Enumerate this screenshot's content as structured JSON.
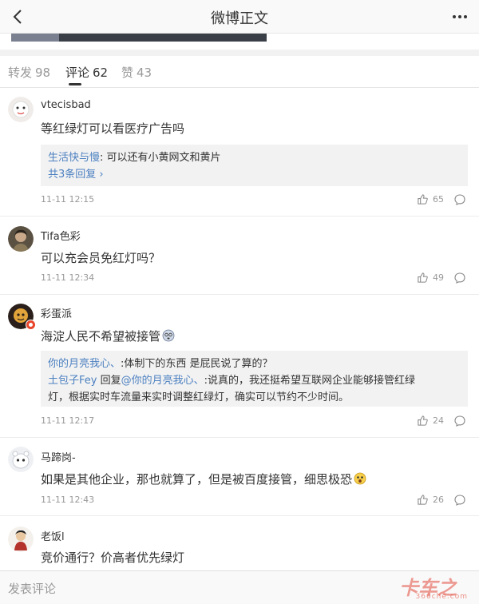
{
  "header": {
    "title": "微博正文",
    "back_icon": "chevron-left-icon",
    "more_icon": "ellipsis-icon"
  },
  "tabs": [
    {
      "label": "转发",
      "count": "98",
      "active": false
    },
    {
      "label": "评论",
      "count": "62",
      "active": true
    },
    {
      "label": "赞",
      "count": "43",
      "active": false
    }
  ],
  "comments": [
    {
      "user": "vtecisbad",
      "text": "等红绿灯可以看医疗广告吗",
      "replies": [
        {
          "name": "生活快与慢",
          "text": ": 可以还有小黄网文和黄片"
        }
      ],
      "more_replies": "共3条回复",
      "time": "11-11 12:15",
      "likes": "65"
    },
    {
      "user": "Tifa色彩",
      "text": "可以充会员免红灯吗？",
      "time": "11-11 12:34",
      "likes": "49"
    },
    {
      "user": "彩蛋派",
      "text": "海淀人民不希望被接管",
      "replies": [
        {
          "name": "你的月亮我心、",
          "text": ":体制下的东西 是屁民说了算的？"
        },
        {
          "name": "土包子Fey",
          "mid": " 回复",
          "mention": "@你的月亮我心、",
          "text": ":说真的，我还挺希望互联网企业能够接管红绿",
          "text2": "灯，根据实时车流量来实时调整红绿灯，确实可以节约不少时间。"
        }
      ],
      "time": "11-11 12:17",
      "likes": "24"
    },
    {
      "user": "马蹄岗-",
      "text": "如果是其他企业，那也就算了，但是被百度接管，细思极恐",
      "time": "11-11 12:43",
      "likes": "26"
    },
    {
      "user": "老饭l",
      "text": "竞价通行？价高者优先绿灯"
    }
  ],
  "bottom": {
    "compose_placeholder": "发表评论"
  },
  "watermark": {
    "brand": "卡车之家",
    "domain": "360che.com"
  },
  "colors": {
    "link": "#4c80c1",
    "muted": "#999999",
    "reply_bg": "#f2f2f2"
  }
}
